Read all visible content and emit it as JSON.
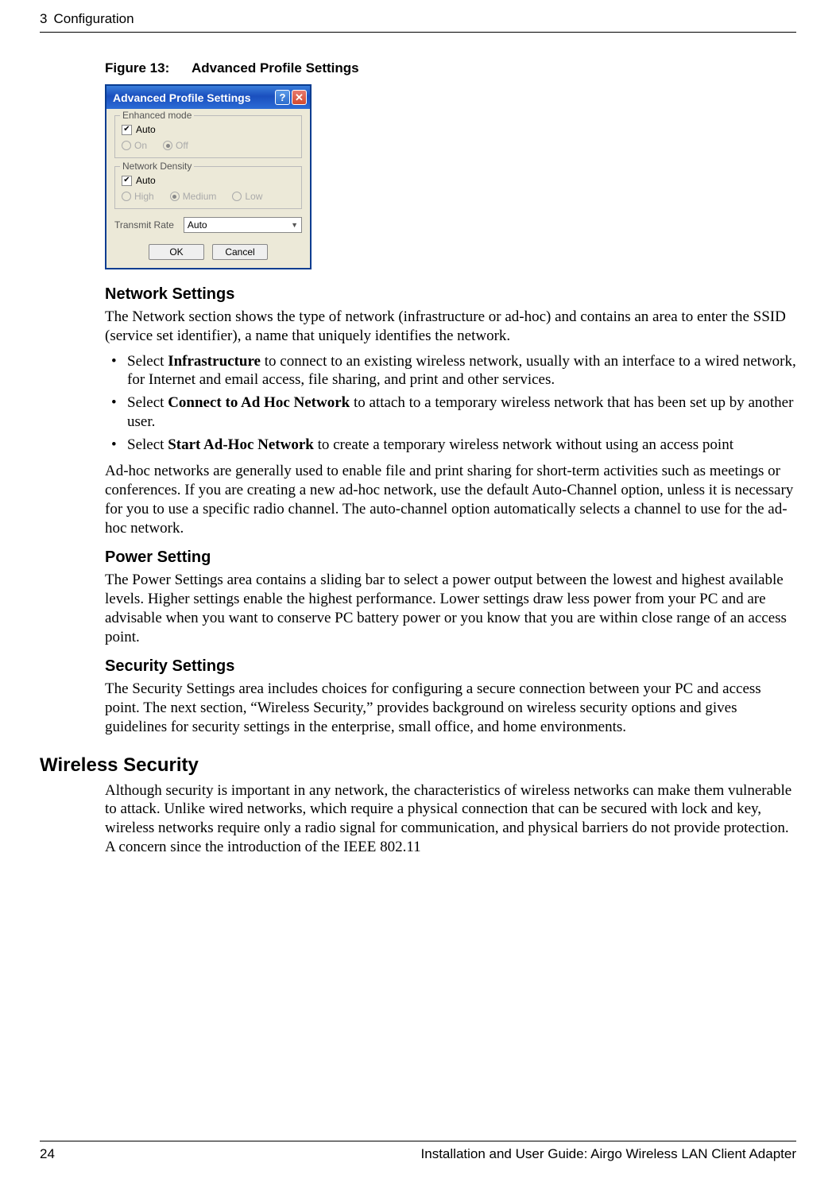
{
  "header": {
    "chapter": "3",
    "chapter_title": "Configuration"
  },
  "figure": {
    "label": "Figure 13:",
    "title": "Advanced Profile Settings"
  },
  "dialog": {
    "title": "Advanced Profile Settings",
    "enhanced_mode": {
      "legend": "Enhanced mode",
      "auto": "Auto",
      "on": "On",
      "off": "Off"
    },
    "network_density": {
      "legend": "Network Density",
      "auto": "Auto",
      "high": "High",
      "medium": "Medium",
      "low": "Low"
    },
    "transmit_rate": {
      "label": "Transmit Rate",
      "value": "Auto"
    },
    "buttons": {
      "ok": "OK",
      "cancel": "Cancel"
    }
  },
  "network_settings": {
    "heading": "Network Settings",
    "intro": "The Network section shows the type of network (infrastructure or ad-hoc) and contains an area to enter the SSID (service set identifier), a name that uniquely identifies the network.",
    "bullet1_pre": "Select ",
    "bullet1_bold": "Infrastructure",
    "bullet1_post": " to connect to an existing wireless network, usually with an interface to a wired network, for Internet and email access, file sharing, and print and other services.",
    "bullet2_pre": "Select ",
    "bullet2_bold": "Connect to Ad Hoc Network",
    "bullet2_post": " to attach to a temporary wireless network that has been set up by another user.",
    "bullet3_pre": "Select ",
    "bullet3_bold": "Start Ad-Hoc Network",
    "bullet3_post": " to create a temporary wireless network without using an access point",
    "para2": "Ad-hoc networks are generally used to enable file and print sharing for short-term activities such as meetings or conferences. If you are creating a new ad-hoc network, use the default Auto-Channel option, unless it is necessary for you to use a specific radio channel. The auto-channel option automatically selects a channel to use for the ad-hoc network."
  },
  "power_setting": {
    "heading": "Power Setting",
    "para": "The Power Settings area contains a sliding bar to select a power output between the lowest and highest available levels. Higher settings enable the highest performance. Lower settings draw less power from your PC and are advisable when you want to conserve PC battery power or you know that you are within close range of an access point."
  },
  "security_settings": {
    "heading": "Security Settings",
    "para": "The Security Settings area includes choices for configuring a secure connection between your PC and access point. The next section, “Wireless Security,” provides background on wireless security options and gives guidelines for security settings in the enterprise, small office, and home environments."
  },
  "wireless_security": {
    "heading": "Wireless Security",
    "para": "Although security is important in any network, the characteristics of wireless networks can make them vulnerable to attack. Unlike wired networks, which require a physical connection that can be secured with lock and key, wireless networks require only a radio signal for communication, and physical barriers do not provide protection. A concern since the introduction of the IEEE 802.11"
  },
  "footer": {
    "page": "24",
    "doc_title": "Installation and User Guide: Airgo Wireless LAN Client Adapter"
  }
}
